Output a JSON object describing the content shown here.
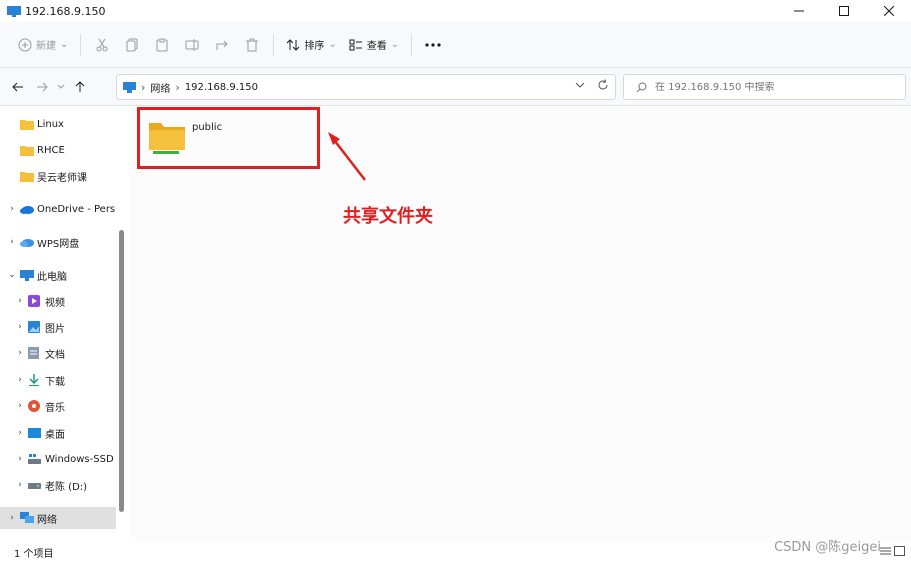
{
  "window": {
    "title": "192.168.9.150",
    "icon": "computer-monitor-icon",
    "controls": [
      "minimize-icon",
      "maximize-icon",
      "close-icon"
    ]
  },
  "toolbar": {
    "new_label": "新建",
    "sort_label": "排序",
    "view_label": "查看",
    "icons": [
      "new-plus-icon",
      "cut-icon",
      "copy-icon",
      "paste-icon",
      "rename-icon",
      "share-icon",
      "delete-icon",
      "sort-icon",
      "view-icon",
      "more-icon"
    ]
  },
  "address": {
    "crumb_root": "网络",
    "crumb_host": "192.168.9.150"
  },
  "search": {
    "placeholder": "在 192.168.9.150 中搜索"
  },
  "sidebar": {
    "items": [
      {
        "label": "Linux",
        "icon": "folder-icon"
      },
      {
        "label": "RHCE",
        "icon": "folder-icon"
      },
      {
        "label": "吴云老师课",
        "icon": "folder-icon"
      },
      {
        "label": "OneDrive - Pers",
        "icon": "onedrive-cloud-icon"
      },
      {
        "label": "WPS网盘",
        "icon": "wps-cloud-icon"
      },
      {
        "label": "此电脑",
        "icon": "this-pc-icon"
      },
      {
        "label": "视频",
        "icon": "videos-icon"
      },
      {
        "label": "图片",
        "icon": "pictures-icon"
      },
      {
        "label": "文档",
        "icon": "documents-icon"
      },
      {
        "label": "下载",
        "icon": "downloads-icon"
      },
      {
        "label": "音乐",
        "icon": "music-icon"
      },
      {
        "label": "桌面",
        "icon": "desktop-icon"
      },
      {
        "label": "Windows-SSD",
        "icon": "drive-icon"
      },
      {
        "label": "老陈 (D:)",
        "icon": "drive-icon"
      },
      {
        "label": "网络",
        "icon": "network-icon"
      }
    ]
  },
  "content": {
    "folder_label": "public",
    "annotation": "共享文件夹"
  },
  "status": {
    "count": "1 个项目",
    "watermark": "CSDN @陈geigei"
  },
  "colors": {
    "highlight": "#e02020",
    "folder": "#f5c13c",
    "share_bar": "#3cb043"
  }
}
